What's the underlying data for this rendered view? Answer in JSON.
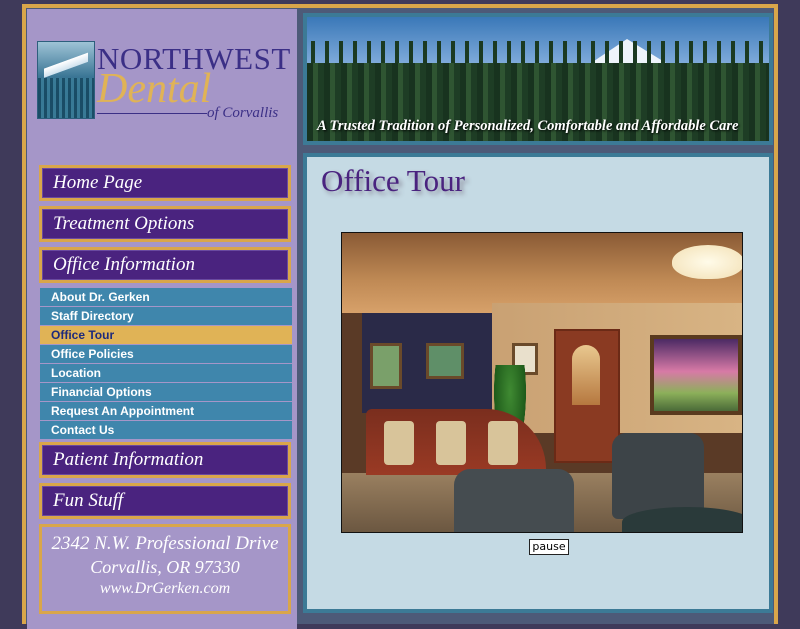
{
  "logo": {
    "northwest": "NORTHWEST",
    "dental": "Dental",
    "of_corvallis": "of Corvallis"
  },
  "banner": {
    "tagline": "A Trusted Tradition of Personalized, Comfortable  and Affordable Care"
  },
  "nav": {
    "main": [
      {
        "label": "Home Page"
      },
      {
        "label": "Treatment Options"
      },
      {
        "label": "Office Information"
      }
    ],
    "sub": [
      {
        "label": "About Dr. Gerken",
        "active": false
      },
      {
        "label": "Staff Directory",
        "active": false
      },
      {
        "label": "Office Tour",
        "active": true
      },
      {
        "label": "Office Policies",
        "active": false
      },
      {
        "label": "Location",
        "active": false
      },
      {
        "label": "Financial Options",
        "active": false
      },
      {
        "label": "Request An Appointment",
        "active": false
      },
      {
        "label": "Contact Us",
        "active": false
      }
    ],
    "lower": [
      {
        "label": "Patient Information"
      },
      {
        "label": "Fun Stuff"
      }
    ]
  },
  "address": {
    "street": "2342 N.W. Professional Drive",
    "city": "Corvallis, OR 97330",
    "web": "www.DrGerken.com"
  },
  "content": {
    "title": "Office Tour",
    "slideshow": {
      "pause_label": "pause"
    }
  },
  "colors": {
    "nav_bg": "#4a237f",
    "gold": "#d9a64a",
    "sidebar_bg": "#a596c8",
    "subnav_bg": "#3f86ac",
    "subnav_active": "#e0b356",
    "content_bg": "#c5dae4"
  }
}
